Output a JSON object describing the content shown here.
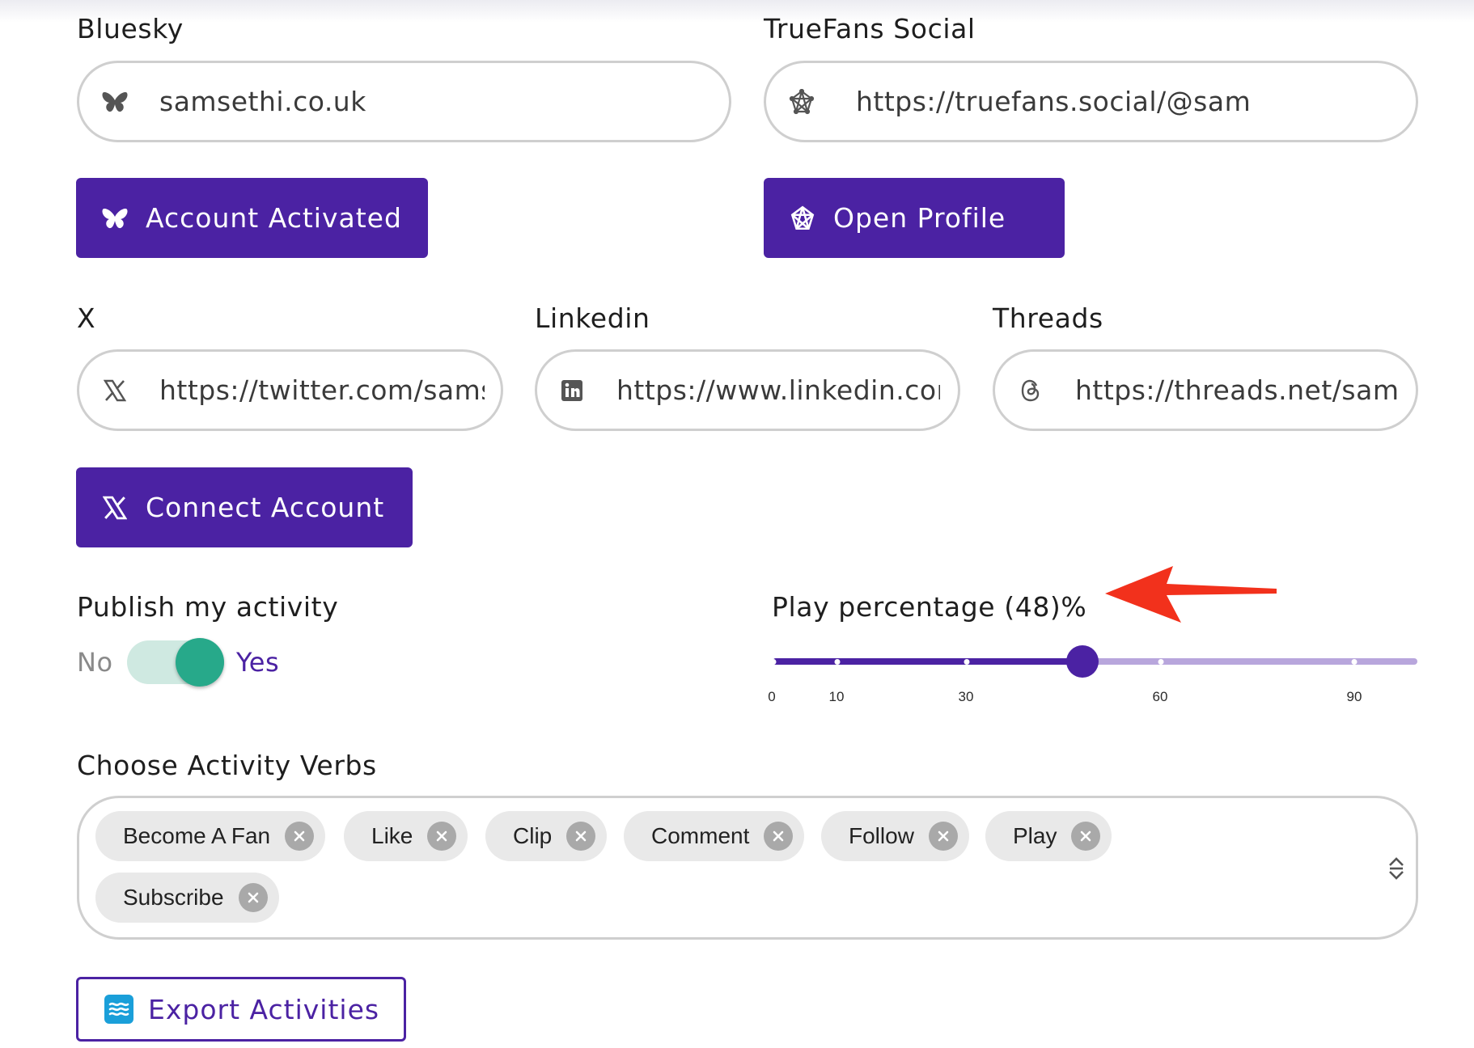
{
  "bluesky": {
    "label": "Bluesky",
    "value": "samsethi.co.uk",
    "icon": "butterfly-icon",
    "button_label": "Account Activated"
  },
  "truefans": {
    "label": "TrueFans Social",
    "value": "https://truefans.social/@sam",
    "icon": "star-network-icon",
    "button_label": "Open Profile"
  },
  "x": {
    "label": "X",
    "value": "https://twitter.com/sams",
    "icon": "x-logo-icon",
    "button_label": "Connect Account"
  },
  "linkedin": {
    "label": "Linkedin",
    "value": "https://www.linkedin.cor",
    "icon": "linkedin-icon"
  },
  "threads": {
    "label": "Threads",
    "value": "https://threads.net/sams",
    "icon": "threads-icon"
  },
  "publish": {
    "label": "Publish my activity",
    "off_label": "No",
    "on_label": "Yes",
    "enabled": true
  },
  "play": {
    "label": "Play percentage (48)%",
    "value": 48,
    "min": 0,
    "max": 100,
    "marks": [
      "0",
      "10",
      "30",
      "60",
      "90"
    ]
  },
  "verbs": {
    "label": "Choose Activity Verbs",
    "chips": [
      "Become A Fan",
      "Like",
      "Clip",
      "Comment",
      "Follow",
      "Play",
      "Subscribe"
    ]
  },
  "export": {
    "button_label": "Export Activities",
    "icon": "waves-app-icon"
  },
  "colors": {
    "primary": "#4b22a3",
    "toggle_on": "#27a98a",
    "toggle_track": "#cfe9e1",
    "slider_rail": "#b8a6dc",
    "annotation_arrow": "#f2311c"
  }
}
